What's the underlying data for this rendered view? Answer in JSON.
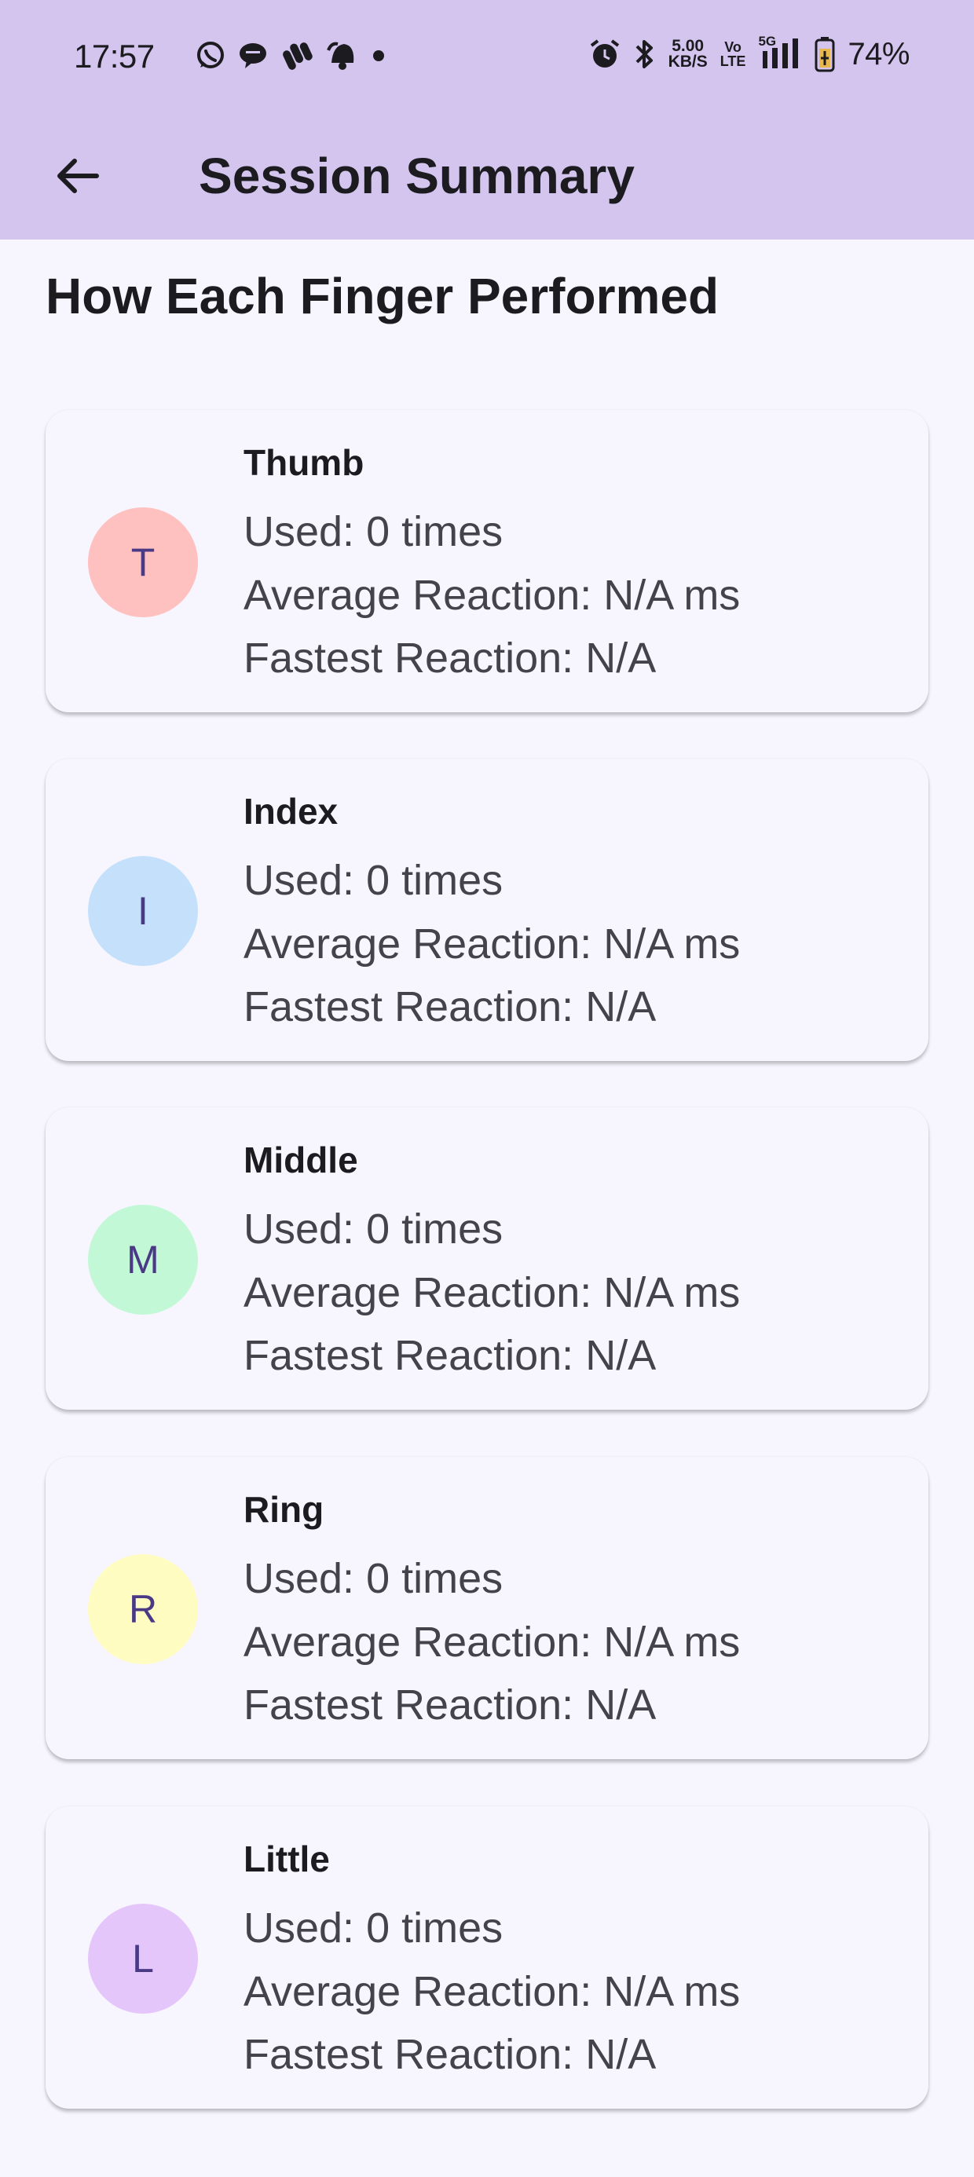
{
  "status_bar": {
    "time": "17:57",
    "notification_icons": [
      "whatsapp-icon",
      "chat-bubble-icon",
      "slack-icon",
      "bell-icon",
      "dot-icon"
    ],
    "alarm_icon": "alarm-icon",
    "bluetooth_icon": "bluetooth-icon",
    "speed_value": "5.00",
    "speed_unit": "KB/S",
    "volte_top": "Vo",
    "volte_bottom": "LTE",
    "network_label": "5G",
    "battery_percent": "74%"
  },
  "header": {
    "back_icon": "arrow-left-icon",
    "title": "Session Summary",
    "background": "#d4c5ef"
  },
  "section_title": "How Each Finger Performed",
  "fingers": [
    {
      "initial": "T",
      "name": "Thumb",
      "used": "Used: 0 times",
      "average": "Average Reaction: N/A ms",
      "fastest": "Fastest Reaction: N/A",
      "color": "#ffc0c0"
    },
    {
      "initial": "I",
      "name": "Index",
      "used": "Used: 0 times",
      "average": "Average Reaction: N/A ms",
      "fastest": "Fastest Reaction: N/A",
      "color": "#c4e0fb"
    },
    {
      "initial": "M",
      "name": "Middle",
      "used": "Used: 0 times",
      "average": "Average Reaction: N/A ms",
      "fastest": "Fastest Reaction: N/A",
      "color": "#c3f8d7"
    },
    {
      "initial": "R",
      "name": "Ring",
      "used": "Used: 0 times",
      "average": "Average Reaction: N/A ms",
      "fastest": "Fastest Reaction: N/A",
      "color": "#fefcc0"
    },
    {
      "initial": "L",
      "name": "Little",
      "used": "Used: 0 times",
      "average": "Average Reaction: N/A ms",
      "fastest": "Fastest Reaction: N/A",
      "color": "#e5c6fa"
    }
  ]
}
